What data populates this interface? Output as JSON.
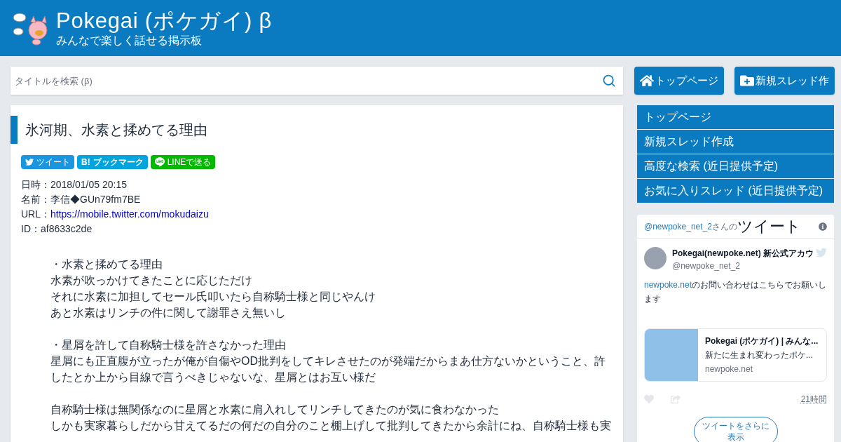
{
  "header": {
    "title": "Pokegai (ポケガイ) β",
    "subtitle": "みんなで楽しく話せる掲示板"
  },
  "search": {
    "placeholder": "タイトルを検索 (β)"
  },
  "top_buttons": [
    {
      "kind": "home",
      "label": "トップページ"
    },
    {
      "kind": "new",
      "label": "新規スレッド作"
    }
  ],
  "thread": {
    "title": "氷河期、水素と揉めてる理由",
    "share": [
      {
        "kind": "twitter",
        "label": "ツイート"
      },
      {
        "kind": "hatena",
        "mark": "B!",
        "label": "ブックマーク"
      },
      {
        "kind": "line",
        "label": "LINEで送る"
      }
    ],
    "meta": [
      {
        "label": "日時：",
        "value": "2018/01/05 20:15"
      },
      {
        "label": "名前：",
        "value": "李信◆GUn79fm7BE"
      },
      {
        "label": "URL：",
        "value": "https://mobile.twitter.com/mokudaizu",
        "link": true
      },
      {
        "label": "ID：",
        "value": "af8633c2de"
      }
    ],
    "paragraphs": [
      [
        "・水素と揉めてる理由",
        "水素が吹っかけてきたことに応じただけ",
        "それに水素に加担してセール氏叩いたら自称騎士様と同じやんけ",
        "あと水素はリンチの件に関して謝罪さえ無いし"
      ],
      [
        "・星屑を許して自称騎士様を許さなかった理由",
        "星屑にも正直腹が立ったが俺が自傷やOD批判をしてキレさせたのが発端だからまあ仕方ないかということ、許したとか上から目線で言うべきじゃないな、星屑とはお互い様だ"
      ],
      [
        "自称騎士様は無関係なのに星屑と水素に肩入れしてリンチしてきたのが気に食わなかった",
        "しかも実家暮らしだから甘えてるだの何だの自分のこと棚上げして批判してきたから余計にね、自称騎士様も実"
      ]
    ]
  },
  "menu": [
    "トップページ",
    "新規スレッド作成",
    "高度な検索 (近日提供予定)",
    "お気に入りスレッド (近日提供予定)"
  ],
  "timeline": {
    "handle": "@newpoke_net_2",
    "suffix": "さんの",
    "title": "ツイート",
    "tweet": {
      "name": "Pokegai(newpoke.net) 新公式アカウ",
      "screen_name": "@newpoke_net_2",
      "link": "newpoke.net",
      "text": "のお問い合わせはこちらでお願いします",
      "card": {
        "title": "Pokegai (ポケガイ) | みんな...",
        "description": "新たに生まれ変わったポケ...",
        "domain": "newpoke.net"
      },
      "time": "21時間"
    },
    "more": "ツイートをさらに表示"
  }
}
